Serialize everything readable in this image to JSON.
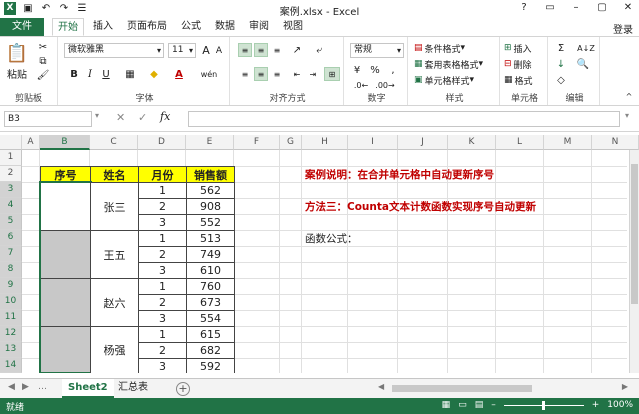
{
  "window": {
    "title": "案例.xlsx - Excel",
    "win_buttons": [
      "?",
      "▭",
      "–",
      "▢",
      "✕"
    ]
  },
  "tabs": [
    "文件",
    "开始",
    "插入",
    "页面布局",
    "公式",
    "数据",
    "审阅",
    "视图"
  ],
  "login": "登录",
  "ribbon": {
    "clipboard": {
      "paste": "粘贴",
      "label": "剪贴板"
    },
    "font": {
      "name": "微软雅黑",
      "size": "11",
      "bold": "B",
      "italic": "I",
      "underline": "U",
      "grow": "A",
      "shrink": "A",
      "font_color": "A",
      "wen": "wén",
      "label": "字体"
    },
    "alignment": {
      "label": "对齐方式"
    },
    "number": {
      "format": "常规",
      "percent": "%",
      "comma": ",",
      "currency": "¥",
      "label": "数字"
    },
    "styles": {
      "conditional": "条件格式",
      "table": "套用表格格式",
      "cell": "单元格样式",
      "label": "样式"
    },
    "cells": {
      "insert": "插入",
      "delete": "删除",
      "format": "格式",
      "label": "单元格"
    },
    "editing": {
      "sum": "Σ",
      "fill": "↓",
      "clear": "◇",
      "sort": "A↓Z",
      "find": "🔍",
      "label": "编辑"
    }
  },
  "formula_bar": {
    "name_box": "B3",
    "fx": "fx",
    "value": ""
  },
  "columns": [
    "A",
    "B",
    "C",
    "D",
    "E",
    "F",
    "G",
    "H",
    "I",
    "J",
    "K",
    "L",
    "M",
    "N"
  ],
  "rows": [
    "1",
    "2",
    "3",
    "4",
    "5",
    "6",
    "7",
    "8",
    "9",
    "10",
    "11",
    "12",
    "13",
    "14"
  ],
  "table": {
    "headers": [
      "序号",
      "姓名",
      "月份",
      "销售额"
    ],
    "groups": [
      {
        "name": "张三",
        "months": [
          "1",
          "2",
          "3"
        ],
        "sales": [
          "562",
          "908",
          "552"
        ]
      },
      {
        "name": "王五",
        "months": [
          "1",
          "2",
          "3"
        ],
        "sales": [
          "513",
          "749",
          "610"
        ]
      },
      {
        "name": "赵六",
        "months": [
          "1",
          "2",
          "3"
        ],
        "sales": [
          "760",
          "673",
          "554"
        ]
      },
      {
        "name": "杨强",
        "months": [
          "1",
          "2",
          "3"
        ],
        "sales": [
          "615",
          "682",
          "592"
        ]
      }
    ]
  },
  "notes": {
    "line1": "案例说明：在合并单元格中自动更新序号",
    "line2": "方法三：Counta文本计数函数实现序号自动更新",
    "line3": "函数公式："
  },
  "sheets": [
    "Sheet2",
    "汇总表"
  ],
  "status": {
    "ready": "就绪",
    "zoom": "100%"
  },
  "colors": {
    "accent": "#217346",
    "header_fill": "#ffff00",
    "note_red": "#c00000",
    "selected_fill": "#c8c8c8"
  }
}
